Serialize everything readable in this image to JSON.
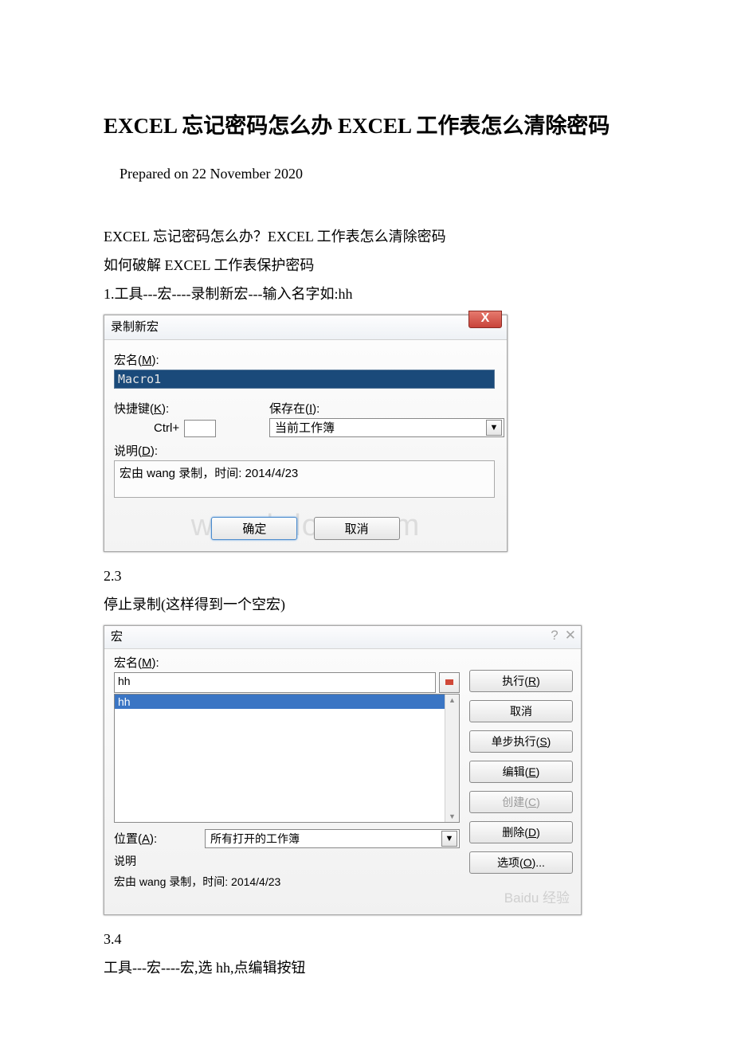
{
  "title": "EXCEL 忘记密码怎么办 EXCEL 工作表怎么清除密码",
  "prepared": "Prepared on 22 November 2020",
  "p1": "EXCEL 忘记密码怎么办？EXCEL 工作表怎么清除密码",
  "p2": "如何破解 EXCEL 工作表保护密码",
  "p3": "1.工具---宏----录制新宏---输入名字如:hh",
  "dlg1": {
    "title": "录制新宏",
    "name_label_pre": "宏名(",
    "name_label_u": "M",
    "name_label_post": "):",
    "name_value": "Macro1",
    "shortcut_label_pre": "快捷键(",
    "shortcut_label_u": "K",
    "shortcut_label_post": "):",
    "ctrl": "Ctrl+",
    "save_label_pre": "保存在(",
    "save_label_u": "I",
    "save_label_post": "):",
    "save_value": "当前工作簿",
    "desc_label_pre": "说明(",
    "desc_label_u": "D",
    "desc_label_post": "):",
    "desc_value": "宏由 wang 录制，时间: 2014/4/23",
    "ok": "确定",
    "cancel": "取消",
    "watermark": "www.bdocx.com"
  },
  "p4": "2.3",
  "p5": "停止录制(这样得到一个空宏)",
  "dlg2": {
    "title": "宏",
    "name_label_pre": "宏名(",
    "name_label_u": "M",
    "name_label_post": "):",
    "name_value": "hh",
    "list_item": "hh",
    "run_pre": "执行(",
    "run_u": "R",
    "run_post": ")",
    "cancel": "取消",
    "step_pre": "单步执行(",
    "step_u": "S",
    "step_post": ")",
    "edit_pre": "编辑(",
    "edit_u": "E",
    "edit_post": ")",
    "create_pre": "创建(",
    "create_u": "C",
    "create_post": ")",
    "delete_pre": "删除(",
    "delete_u": "D",
    "delete_post": ")",
    "options_pre": "选项(",
    "options_u": "O",
    "options_post": ")...",
    "loc_label_pre": "位置(",
    "loc_label_u": "A",
    "loc_label_post": "):",
    "loc_value": "所有打开的工作簿",
    "desc_label": "说明",
    "desc_value": "宏由 wang 录制，时间: 2014/4/23",
    "baidu": "Baidu 经验"
  },
  "p6": "3.4",
  "p7": "工具---宏----宏,选 hh,点编辑按钮"
}
